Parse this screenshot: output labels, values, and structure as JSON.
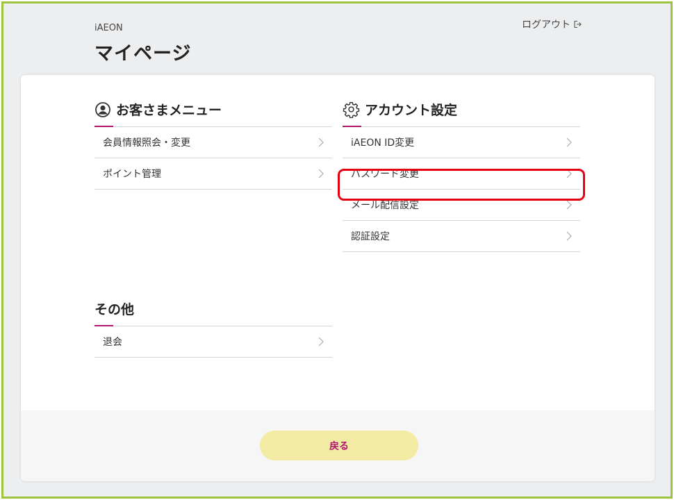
{
  "header": {
    "brand": "iAEON",
    "title": "マイページ",
    "logout_label": "ログアウト"
  },
  "sections": {
    "customer": {
      "title": "お客さまメニュー",
      "items": [
        {
          "label": "会員情報照会・変更"
        },
        {
          "label": "ポイント管理"
        }
      ]
    },
    "account": {
      "title": "アカウント設定",
      "items": [
        {
          "label": "iAEON ID変更"
        },
        {
          "label": "パスワード変更"
        },
        {
          "label": "メール配信設定"
        },
        {
          "label": "認証設定"
        }
      ]
    },
    "other": {
      "title": "その他",
      "items": [
        {
          "label": "退会"
        }
      ]
    }
  },
  "footer": {
    "back_label": "戻る"
  },
  "colors": {
    "accent": "#b0146e",
    "frame_border": "#9bc43f",
    "highlight": "#e60012",
    "back_button_bg": "#f3eaa3"
  }
}
